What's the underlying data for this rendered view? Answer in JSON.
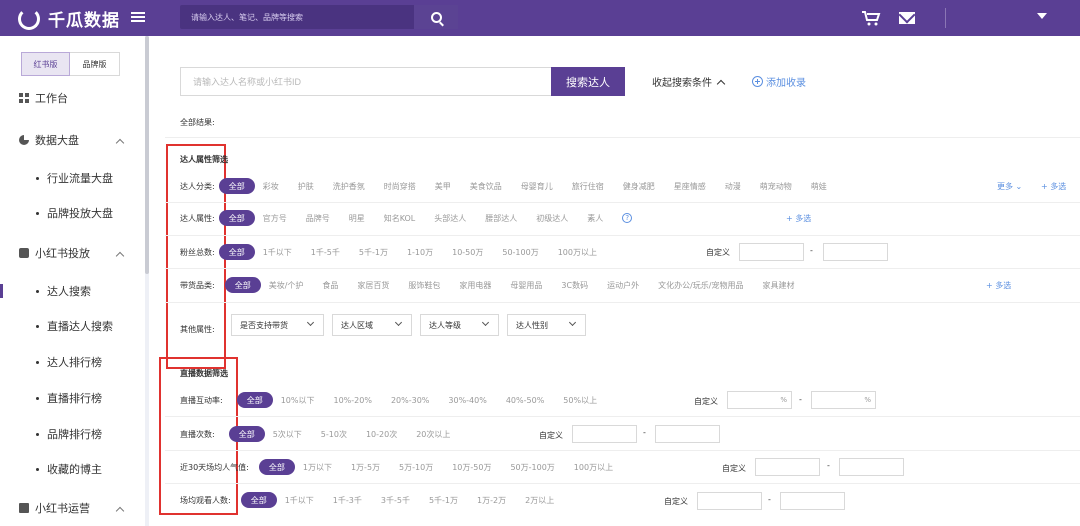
{
  "brand": {
    "name": "千瓜数据"
  },
  "header": {
    "search_placeholder": "请输入达人、笔记、品牌等搜索"
  },
  "sidebar": {
    "version_tabs": [
      "红书版",
      "品牌版"
    ],
    "items": [
      {
        "label": "工作台"
      },
      {
        "label": "数据大盘"
      },
      {
        "label": "行业流量大盘"
      },
      {
        "label": "品牌投放大盘"
      },
      {
        "label": "小红书投放"
      },
      {
        "label": "达人搜索"
      },
      {
        "label": "直播达人搜索"
      },
      {
        "label": "达人排行榜"
      },
      {
        "label": "直播排行榜"
      },
      {
        "label": "品牌排行榜"
      },
      {
        "label": "收藏的博主"
      },
      {
        "label": "小红书运营"
      }
    ]
  },
  "main": {
    "search_placeholder": "请输入达人名称或小红书ID",
    "search_button": "搜索达人",
    "collapse_label": "收起搜索条件",
    "add_favorite": "添加收录",
    "all_results": "全部结果:"
  },
  "filters": {
    "section1_title": "达人属性筛选",
    "section2_title": "直播数据筛选",
    "all": "全部",
    "category": {
      "label": "达人分类:",
      "options": [
        "彩妆",
        "护肤",
        "洗护香氛",
        "时尚穿搭",
        "美甲",
        "美食饮品",
        "母婴育儿",
        "旅行住宿",
        "健身减肥",
        "星座情感",
        "动漫",
        "萌宠动物",
        "萌娃"
      ],
      "more": "更多",
      "multi": "+ 多选"
    },
    "attribute": {
      "label": "达人属性:",
      "options": [
        "官方号",
        "品牌号",
        "明星",
        "知名KOL",
        "头部达人",
        "腰部达人",
        "初级达人",
        "素人"
      ],
      "multi": "+ 多选"
    },
    "fans": {
      "label": "粉丝总数:",
      "options": [
        "1千以下",
        "1千-5千",
        "5千-1万",
        "1-10万",
        "10-50万",
        "50-100万",
        "100万以上"
      ],
      "custom": "自定义"
    },
    "goods": {
      "label": "带货品类:",
      "options": [
        "美妆/个护",
        "食品",
        "家居百货",
        "服饰鞋包",
        "家用电器",
        "母婴用品",
        "3C数码",
        "运动户外",
        "文化办公/玩乐/宠物用品",
        "家具建材"
      ],
      "multi": "+ 多选"
    },
    "other": {
      "label": "其他属性:",
      "dropdowns": [
        "是否支持带货",
        "达人区域",
        "达人等级",
        "达人性别"
      ]
    },
    "interaction": {
      "label": "直播互动率:",
      "options": [
        "10%以下",
        "10%-20%",
        "20%-30%",
        "30%-40%",
        "40%-50%",
        "50%以上"
      ],
      "custom": "自定义",
      "unit": "%"
    },
    "count": {
      "label": "直播次数:",
      "options": [
        "5次以下",
        "5-10次",
        "10-20次",
        "20次以上"
      ],
      "custom": "自定义"
    },
    "popularity": {
      "label": "近30天场均人气值:",
      "options": [
        "1万以下",
        "1万-5万",
        "5万-10万",
        "10万-50万",
        "50万-100万",
        "100万以上"
      ],
      "custom": "自定义"
    },
    "viewers": {
      "label": "场均观看人数:",
      "options": [
        "1千以下",
        "1千-3千",
        "3千-5千",
        "5千-1万",
        "1万-2万",
        "2万以上"
      ],
      "custom": "自定义"
    },
    "dash": "-"
  },
  "colors": {
    "brand": "#5a3f94",
    "link": "#5b8fe0",
    "highlight": "#e0322f"
  }
}
